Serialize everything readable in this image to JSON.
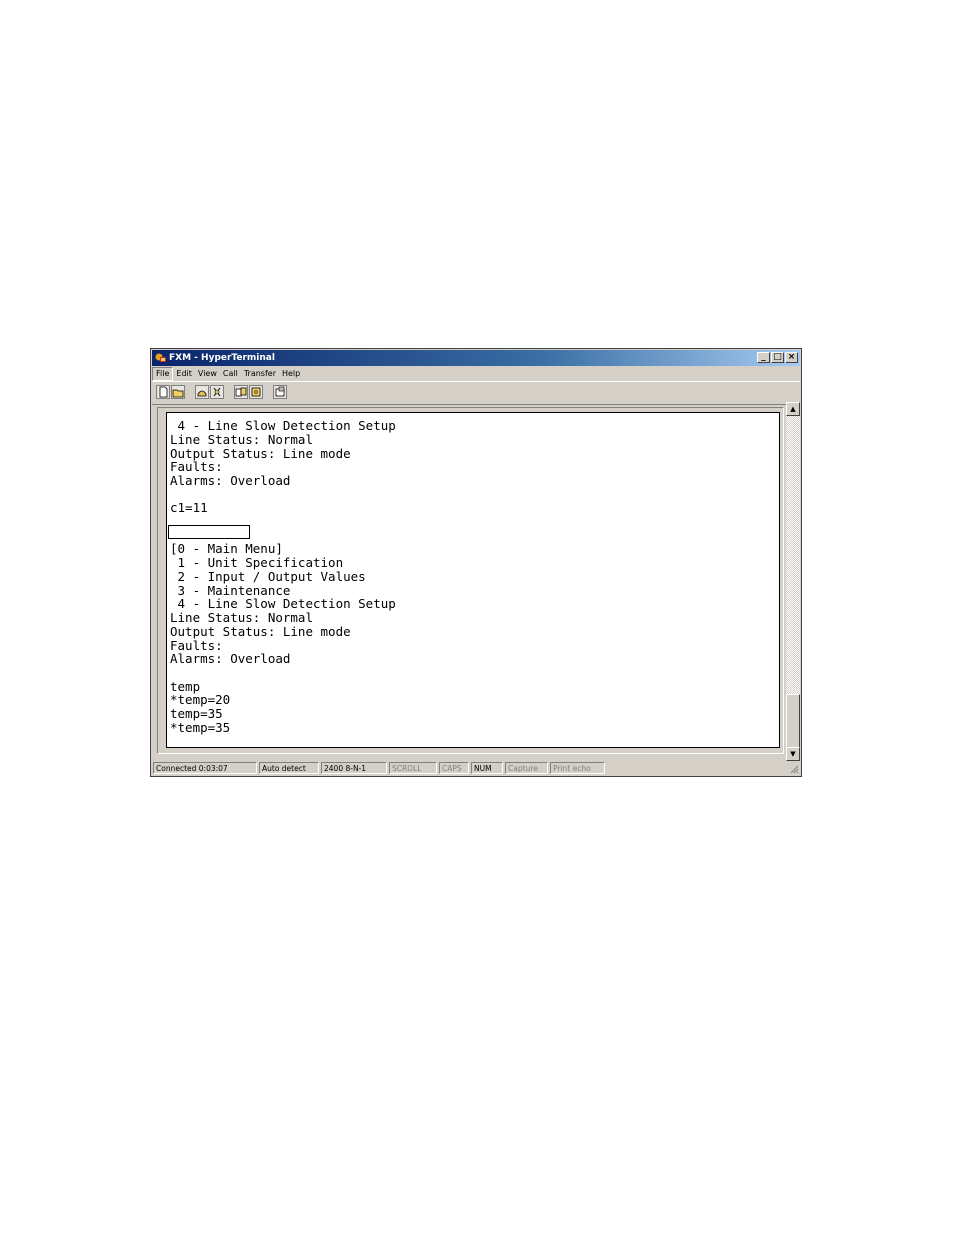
{
  "window": {
    "title": "FXM - HyperTerminal",
    "caption_buttons": {
      "minimize": "_",
      "maximize": "□",
      "close": "×"
    }
  },
  "menu": [
    "File",
    "Edit",
    "View",
    "Call",
    "Transfer",
    "Help"
  ],
  "toolbar": {
    "icons": [
      "new-icon",
      "open-icon",
      "call-icon",
      "disconnect-icon",
      "send-icon",
      "receive-icon",
      "properties-icon"
    ]
  },
  "terminal": {
    "lines": [
      " 4 - Line Slow Detection Setup",
      "Line Status: Normal",
      "Output Status: Line mode",
      "Faults:",
      "Alarms: Overload",
      "",
      "c1=11",
      "",
      "",
      "[0 - Main Menu]",
      " 1 - Unit Specification",
      " 2 - Input / Output Values",
      " 3 - Maintenance",
      " 4 - Line Slow Detection Setup",
      "Line Status: Normal",
      "Output Status: Line mode",
      "Faults:",
      "Alarms: Overload",
      "",
      "temp",
      "*temp=20",
      "temp=35",
      "*temp=35"
    ]
  },
  "scrollbar": {
    "up": "▲",
    "down": "▼"
  },
  "statusbar": {
    "connected": "Connected 0:03:07",
    "detect": "Auto detect",
    "settings": "2400 8-N-1",
    "scroll": "SCROLL",
    "caps": "CAPS",
    "num": "NUM",
    "capture": "Capture",
    "print_echo": "Print echo"
  }
}
